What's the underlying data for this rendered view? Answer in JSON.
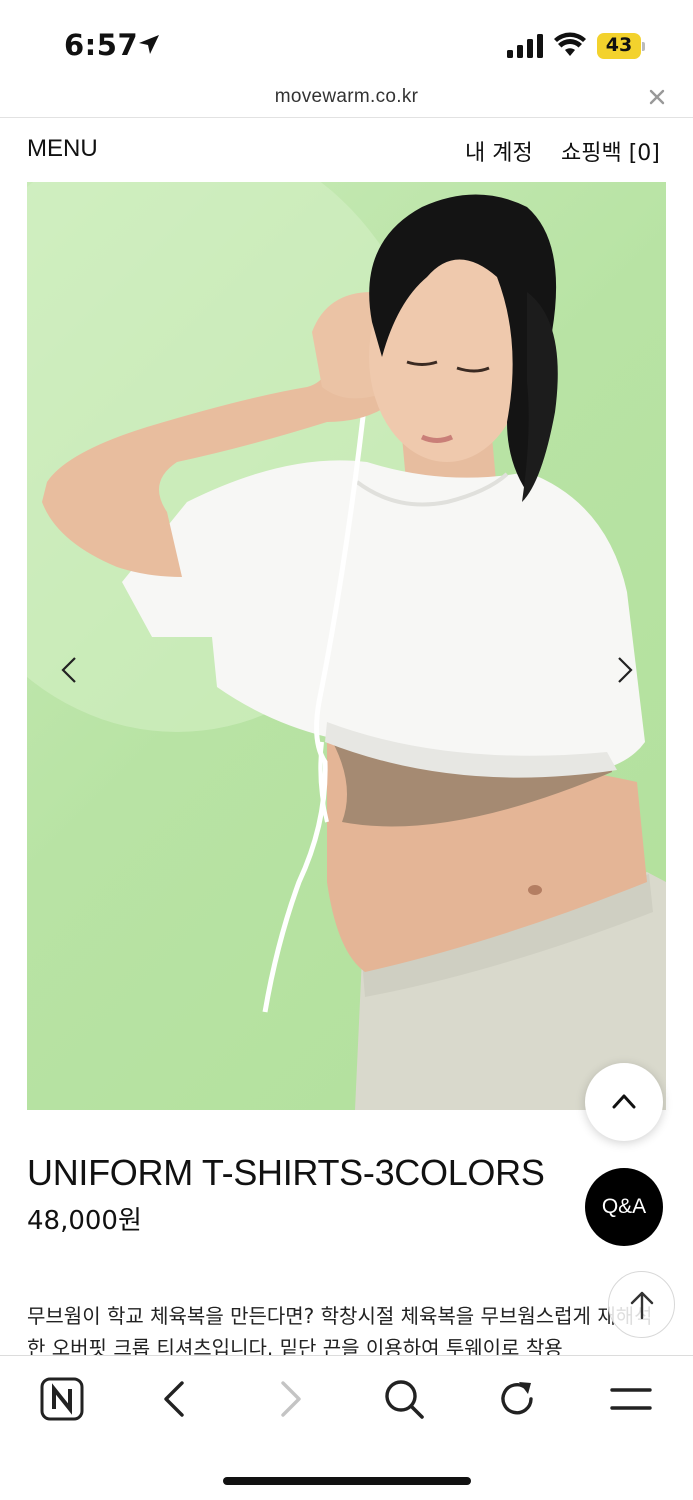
{
  "status": {
    "time": "6:57",
    "battery": "43"
  },
  "browser": {
    "url": "movewarm.co.kr"
  },
  "header": {
    "menu_label": "MENU",
    "account_label": "내 계정",
    "bag_label": "쇼핑백 [0]"
  },
  "product": {
    "name": "UNIFORM T-SHIRTS-3COLORS",
    "price": "48,000원",
    "description": "무브웜이 학교 체육복을 만든다면? 학창시절 체육복을 무브웜스럽게 재해석한 오버핏 크롭 티셔츠입니다. 밑단 끈을 이용하여 투웨이로 착용"
  },
  "floating": {
    "qa_label": "Q&A"
  },
  "icons": {
    "location": "location-arrow-icon",
    "signal": "cellular-signal-icon",
    "wifi": "wifi-icon",
    "close": "close-icon",
    "prev": "chevron-left-icon",
    "next": "chevron-right-icon",
    "scroll_top": "chevron-up-icon",
    "scroll_up": "arrow-up-icon",
    "home": "naver-n-icon",
    "back": "back-icon",
    "forward": "forward-icon",
    "search": "search-icon",
    "refresh": "refresh-icon",
    "menu": "hamburger-icon"
  },
  "colors": {
    "hero_background": "#b8e3a4",
    "battery": "#f3d22d",
    "qa_button": "#000000"
  }
}
